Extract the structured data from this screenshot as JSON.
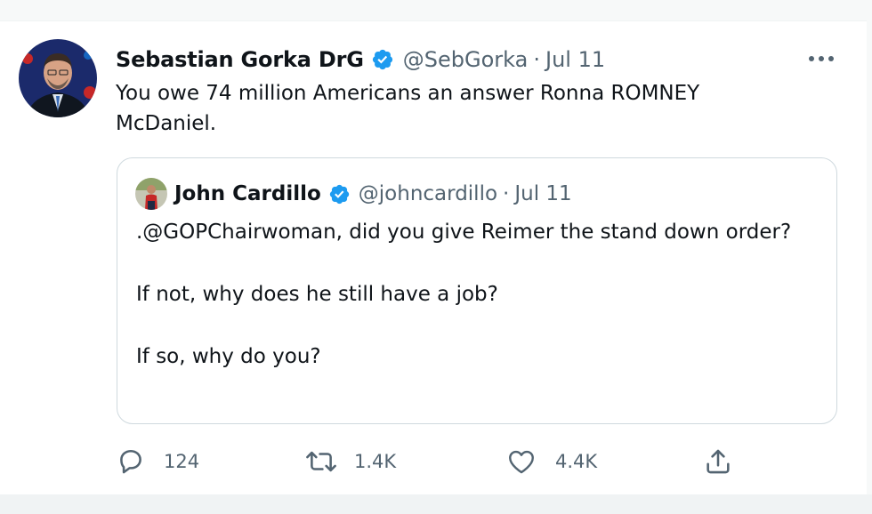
{
  "tweet": {
    "author_name": "Sebastian Gorka DrG",
    "handle": "@SebGorka",
    "separator": "·",
    "date": "Jul 11",
    "text": "You owe 74 million Americans an answer Ronna ROMNEY McDaniel."
  },
  "quoted": {
    "author_name": "John Cardillo",
    "handle": "@johncardillo",
    "separator": "·",
    "date": "Jul 11",
    "lines": [
      ".@GOPChairwoman, did you give Reimer the stand down order?",
      "If not, why does he still have a job?",
      "If so, why do you?"
    ]
  },
  "actions": {
    "reply_count": "124",
    "retweet_count": "1.4K",
    "like_count": "4.4K"
  },
  "colors": {
    "verified": "#1d9bf0",
    "secondary_text": "#536471",
    "border": "#cfd9de"
  },
  "icons": [
    "more-icon",
    "verified-icon",
    "reply-icon",
    "retweet-icon",
    "like-icon",
    "share-icon"
  ]
}
